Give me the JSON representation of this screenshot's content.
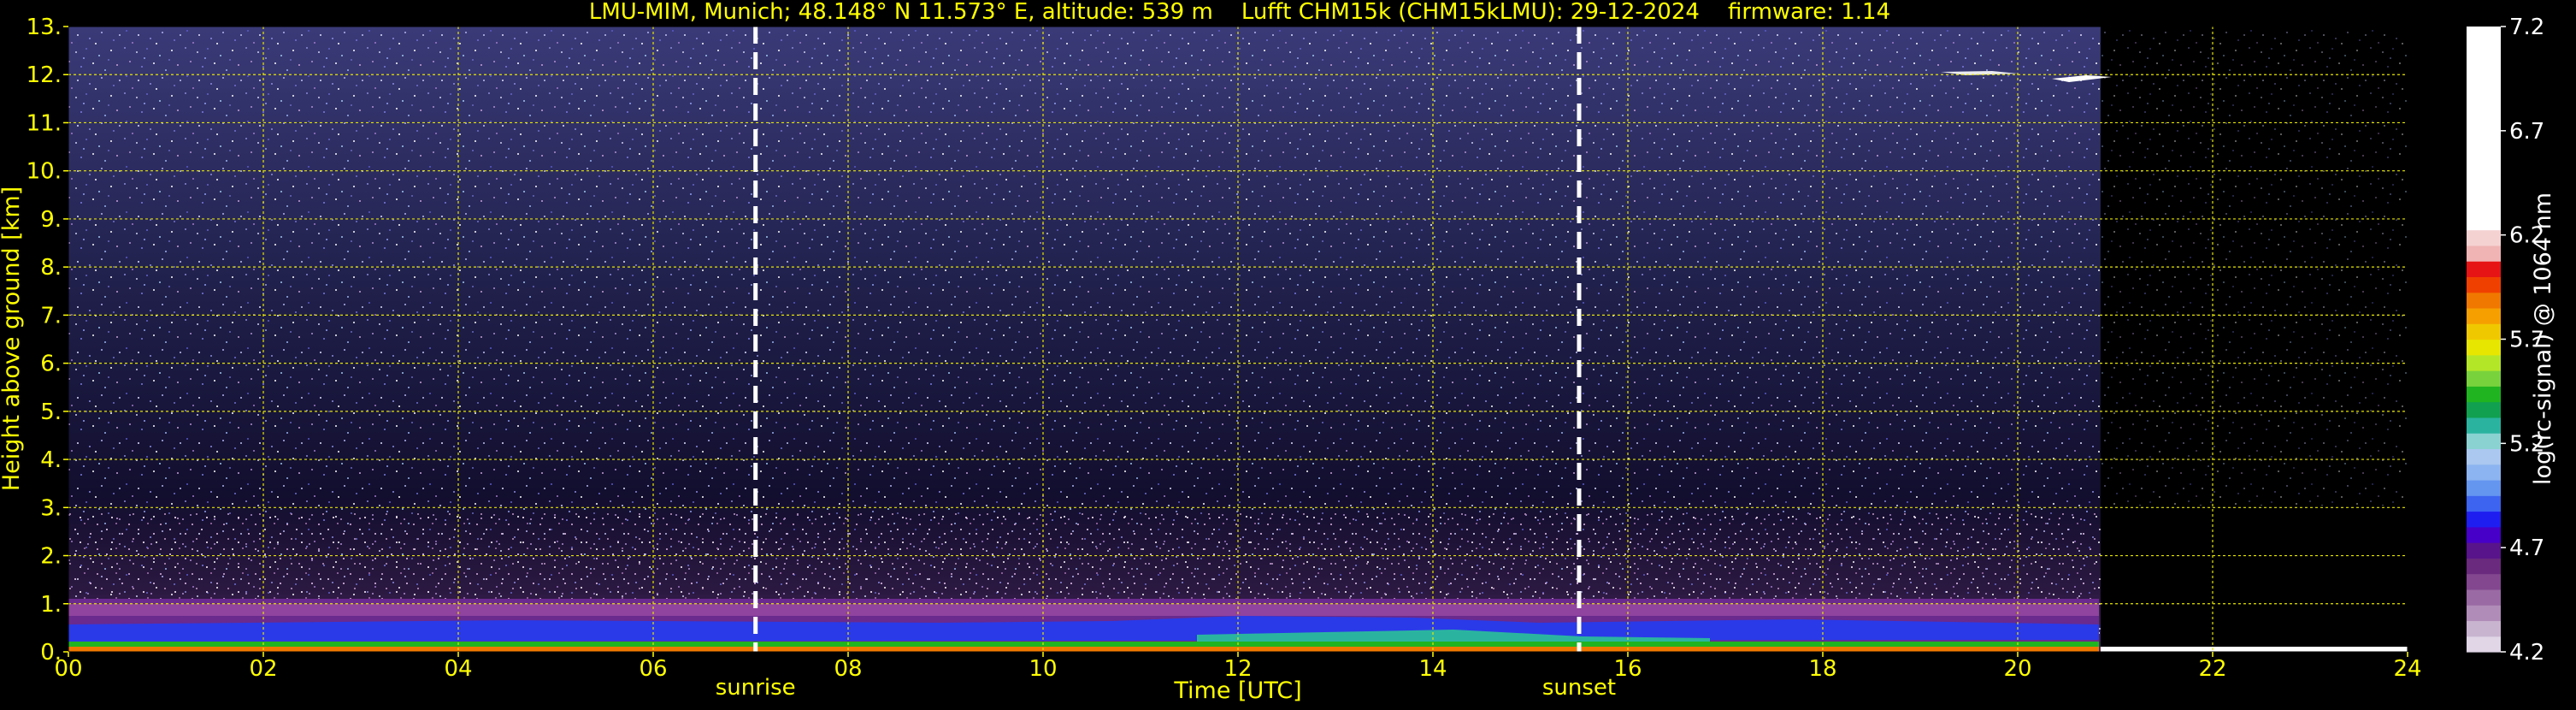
{
  "chart_data": {
    "type": "heatmap",
    "title": "LMU-MIM, Munich; 48.148° N 11.573° E, altitude: 539 m    Lufft CHM15k (CHM15kLMU): 29-12-2024    firmware: 1.14",
    "xlabel": "Time [UTC]",
    "ylabel": "Height above ground [km]",
    "xlim": [
      0,
      24
    ],
    "ylim": [
      0,
      13
    ],
    "x_ticks": [
      "00",
      "02",
      "04",
      "06",
      "08",
      "10",
      "12",
      "14",
      "16",
      "18",
      "20",
      "22",
      "24"
    ],
    "y_ticks": [
      "0.",
      "1.",
      "2.",
      "3.",
      "4.",
      "5.",
      "6.",
      "7.",
      "8.",
      "9.",
      "10.",
      "11.",
      "12.",
      "13."
    ],
    "grid": true,
    "grid_color": "#e6e600",
    "events": [
      {
        "label": "sunrise",
        "time": 7.05
      },
      {
        "label": "sunset",
        "time": 15.5
      }
    ],
    "instrument_off_after": 20.85,
    "colorbar": {
      "label": "log(rc-signal) @ 1064 nm",
      "min": 4.2,
      "max": 7.2,
      "tick_labels": [
        "4.2",
        "4.7",
        "5.2",
        "5.7",
        "6.2",
        "6.7",
        "7.2"
      ],
      "colors": [
        "#e0d6e6",
        "#c9b4d0",
        "#b08cb8",
        "#9a6aa4",
        "#83478f",
        "#6a2a7e",
        "#58148a",
        "#4600c8",
        "#1e1ef0",
        "#3c64f0",
        "#6496f0",
        "#8cb4f0",
        "#aac8f0",
        "#8ad2d2",
        "#2ab4a0",
        "#10a050",
        "#20b420",
        "#78d23c",
        "#b4e628",
        "#e6e600",
        "#f0c800",
        "#f5a000",
        "#f07800",
        "#f04000",
        "#e61414",
        "#f0b4b4",
        "#f5d2d2",
        "#ffffff",
        "#ffffff",
        "#ffffff",
        "#ffffff",
        "#ffffff",
        "#ffffff",
        "#ffffff",
        "#ffffff",
        "#ffffff",
        "#ffffff",
        "#ffffff",
        "#ffffff",
        "#ffffff"
      ]
    }
  }
}
